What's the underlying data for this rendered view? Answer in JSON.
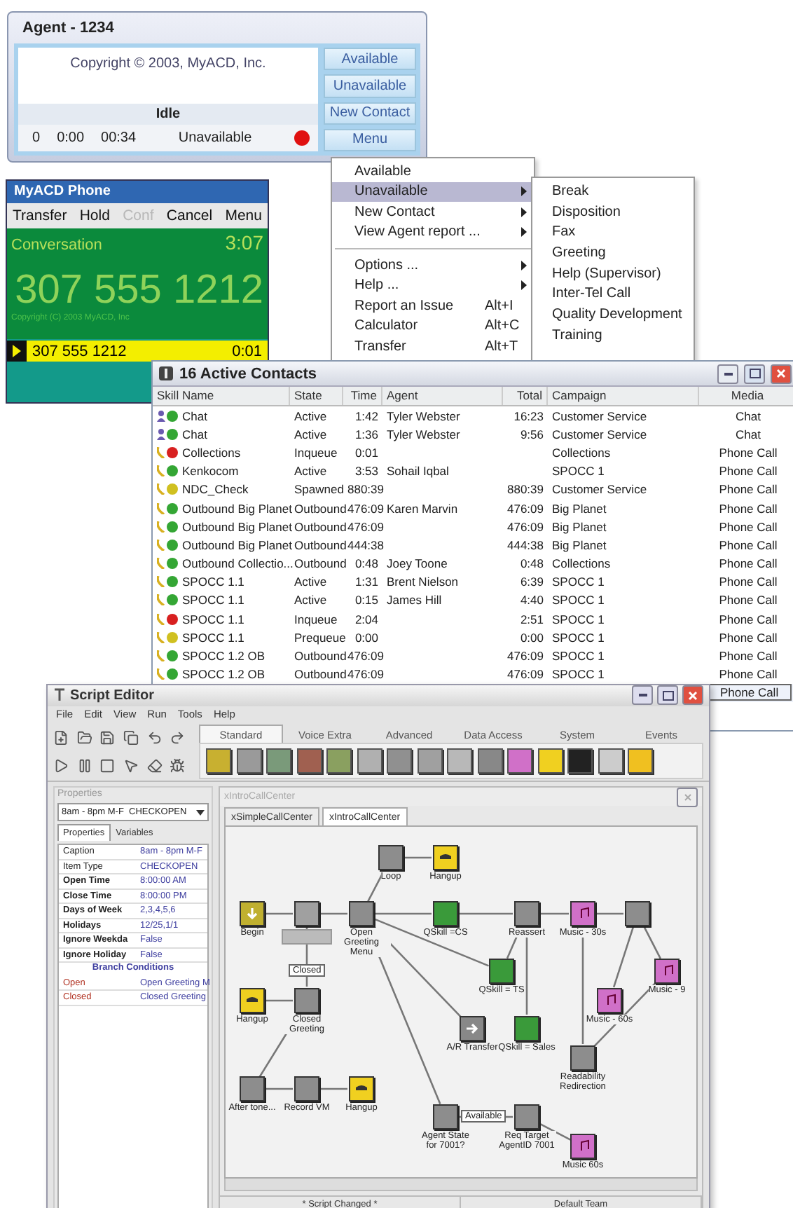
{
  "agent_window": {
    "title": "Agent - 1234",
    "copyright": "Copyright © 2003, MyACD, Inc.",
    "status": "Idle",
    "stats": [
      "0",
      "0:00",
      "00:34"
    ],
    "state": "Unavailable",
    "available": false,
    "buttons": [
      "Available",
      "Unavailable",
      "New Contact",
      "Menu"
    ]
  },
  "menu": {
    "items": [
      {
        "kind": "item",
        "label": "Available",
        "selected": false,
        "submenu": false
      },
      {
        "kind": "item",
        "label": "Unavailable",
        "selected": true,
        "submenu": true
      },
      {
        "kind": "item",
        "label": "New Contact",
        "selected": false,
        "submenu": true
      },
      {
        "kind": "item",
        "label": "View Agent report ...",
        "selected": false,
        "submenu": true
      },
      {
        "kind": "separator"
      },
      {
        "kind": "item",
        "label": "Options ...",
        "selected": false,
        "submenu": true
      },
      {
        "kind": "item",
        "label": "Help ...",
        "selected": false,
        "submenu": true
      },
      {
        "kind": "item",
        "label": "Report an Issue",
        "selected": false,
        "submenu": false,
        "shortcut": "Alt+I"
      },
      {
        "kind": "item",
        "label": "Calculator",
        "selected": false,
        "submenu": false,
        "shortcut": "Alt+C"
      },
      {
        "kind": "item",
        "label": "Transfer",
        "selected": false,
        "submenu": false,
        "shortcut": "Alt+T"
      }
    ]
  },
  "submenu": {
    "items": [
      "Break",
      "Disposition",
      "Fax",
      "Greeting",
      "Help (Supervisor)",
      "Inter-Tel Call",
      "Quality Development",
      "Training"
    ]
  },
  "phone": {
    "title": "MyACD Phone",
    "toolbar": [
      {
        "label": "Transfer",
        "disabled": false
      },
      {
        "label": "Hold",
        "disabled": false
      },
      {
        "label": "Conf",
        "disabled": true
      },
      {
        "label": "Cancel",
        "disabled": false
      },
      {
        "label": "Menu",
        "disabled": false
      }
    ],
    "state": "Conversation",
    "timer": "3:07",
    "number": "307 555 1212",
    "copyright": "Copyright (C) 2003 MyACD, Inc",
    "line": {
      "number": "307 555 1212",
      "time": "0:01"
    }
  },
  "contacts": {
    "title": "16 Active Contacts",
    "columns": [
      "Skill Name",
      "State",
      "Time",
      "Agent",
      "Total",
      "Campaign",
      "Media"
    ],
    "rows": [
      {
        "kind": "chat",
        "color": "#34a634",
        "skill": "Chat",
        "state": "Active",
        "time": "1:42",
        "agent": "Tyler Webster",
        "total": "16:23",
        "campaign": "Customer Service",
        "media": "Chat",
        "selected": false
      },
      {
        "kind": "chat",
        "color": "#34a634",
        "skill": "Chat",
        "state": "Active",
        "time": "1:36",
        "agent": "Tyler Webster",
        "total": "9:56",
        "campaign": "Customer Service",
        "media": "Chat",
        "selected": false
      },
      {
        "kind": "phone",
        "color": "#d82020",
        "skill": "Collections",
        "state": "Inqueue",
        "time": "0:01",
        "campaign": "Collections",
        "media": "Phone Call",
        "selected": false
      },
      {
        "kind": "phone",
        "color": "#34a634",
        "skill": "Kenkocom",
        "state": "Active",
        "time": "3:53",
        "agent": "Sohail Iqbal",
        "campaign": "SPOCC 1",
        "media": "Phone Call",
        "selected": false
      },
      {
        "kind": "phone",
        "color": "#d0c020",
        "skill": "NDC_Check",
        "state": "Spawned",
        "time": "880:39",
        "total": "880:39",
        "campaign": "Customer Service",
        "media": "Phone Call",
        "selected": false
      },
      {
        "kind": "phone",
        "color": "#34a634",
        "skill": "Outbound Big Planet",
        "state": "Outbound",
        "time": "476:09",
        "agent": "Karen Marvin",
        "total": "476:09",
        "campaign": "Big Planet",
        "media": "Phone Call",
        "selected": false
      },
      {
        "kind": "phone",
        "color": "#34a634",
        "skill": "Outbound Big Planet",
        "state": "Outbound",
        "time": "476:09",
        "total": "476:09",
        "campaign": "Big Planet",
        "media": "Phone Call",
        "selected": false
      },
      {
        "kind": "phone",
        "color": "#34a634",
        "skill": "Outbound Big Planet",
        "state": "Outbound",
        "time": "444:38",
        "total": "444:38",
        "campaign": "Big Planet",
        "media": "Phone Call",
        "selected": false
      },
      {
        "kind": "phone",
        "color": "#34a634",
        "skill": "Outbound Collectio...",
        "state": "Outbound",
        "time": "0:48",
        "agent": "Joey Toone",
        "total": "0:48",
        "campaign": "Collections",
        "media": "Phone Call",
        "selected": false
      },
      {
        "kind": "phone",
        "color": "#34a634",
        "skill": "SPOCC 1.1",
        "state": "Active",
        "time": "1:31",
        "agent": "Brent Nielson",
        "total": "6:39",
        "campaign": "SPOCC 1",
        "media": "Phone Call",
        "selected": false
      },
      {
        "kind": "phone",
        "color": "#34a634",
        "skill": "SPOCC 1.1",
        "state": "Active",
        "time": "0:15",
        "agent": "James Hill",
        "total": "4:40",
        "campaign": "SPOCC 1",
        "media": "Phone Call",
        "selected": false
      },
      {
        "kind": "phone",
        "color": "#d82020",
        "skill": "SPOCC 1.1",
        "state": "Inqueue",
        "time": "2:04",
        "total": "2:51",
        "campaign": "SPOCC 1",
        "media": "Phone Call",
        "selected": false
      },
      {
        "kind": "phone",
        "color": "#d0c020",
        "skill": "SPOCC 1.1",
        "state": "Prequeue",
        "time": "0:00",
        "total": "0:00",
        "campaign": "SPOCC 1",
        "media": "Phone Call",
        "selected": false
      },
      {
        "kind": "phone",
        "color": "#34a634",
        "skill": "SPOCC 1.2 OB",
        "state": "Outbound",
        "time": "476:09",
        "total": "476:09",
        "campaign": "SPOCC 1",
        "media": "Phone Call",
        "selected": false
      },
      {
        "kind": "phone",
        "color": "#34a634",
        "skill": "SPOCC 1.2 OB",
        "state": "Outbound",
        "time": "476:09",
        "total": "476:09",
        "campaign": "SPOCC 1",
        "media": "Phone Call",
        "selected": false
      },
      {
        "media": "Phone Call",
        "selected": true
      }
    ]
  },
  "script_editor": {
    "title": "Script Editor",
    "menus": [
      "File",
      "Edit",
      "View",
      "Run",
      "Tools",
      "Help"
    ],
    "palette_tabs": [
      {
        "label": "Standard",
        "selected": true
      },
      {
        "label": "Voice Extra",
        "selected": false
      },
      {
        "label": "Advanced",
        "selected": false
      },
      {
        "label": "Data Access",
        "selected": false
      },
      {
        "label": "System",
        "selected": false
      },
      {
        "label": "Events",
        "selected": false
      }
    ],
    "properties": {
      "title": "Properties",
      "object": "8am - 8pm M-F  CHECKOPEN",
      "tabs": [
        {
          "label": "Properties",
          "selected": true
        },
        {
          "label": "Variables",
          "selected": false
        }
      ],
      "rows": [
        {
          "name": "Caption",
          "value": "8am - 8pm M-F",
          "bold": false
        },
        {
          "name": "Item Type",
          "value": "CHECKOPEN",
          "bold": false
        },
        {
          "name": "Open Time",
          "value": "8:00:00 AM",
          "bold": true
        },
        {
          "name": "Close Time",
          "value": "8:00:00 PM",
          "bold": true
        },
        {
          "name": "Days of Week",
          "value": "2,3,4,5,6",
          "bold": true
        },
        {
          "name": "Holidays",
          "value": "12/25,1/1",
          "bold": true
        },
        {
          "name": "Ignore Weekda",
          "value": "False",
          "bold": true
        },
        {
          "name": "Ignore Holiday",
          "value": "False",
          "bold": true
        }
      ],
      "branch_header": "Branch Conditions",
      "branches": [
        {
          "name": "Open",
          "value": "Open Greeting M"
        },
        {
          "name": "Closed",
          "value": "Closed Greeting"
        }
      ]
    },
    "document": {
      "title": "xIntroCallCenter",
      "tabs": [
        {
          "label": "xSimpleCallCenter",
          "selected": false
        },
        {
          "label": "xIntroCallCenter",
          "selected": true
        }
      ],
      "nodes": [
        {
          "kind": "generic",
          "label": "Loop"
        },
        {
          "kind": "hangup",
          "label": "Hangup"
        },
        {
          "kind": "begin",
          "label": "Begin"
        },
        {
          "kind": "check"
        },
        {
          "kind": "generic",
          "label": "Open Greeting Menu"
        },
        {
          "kind": "queue",
          "label": "QSkill =CS"
        },
        {
          "kind": "generic",
          "label": "Reassert"
        },
        {
          "kind": "music",
          "label": "Music - 30s"
        },
        {
          "kind": "generic"
        },
        {
          "kind": "queue",
          "label": "QSkill = TS"
        },
        {
          "kind": "music",
          "label": "Music - 60s"
        },
        {
          "kind": "music",
          "label": "Music - 9"
        },
        {
          "kind": "hangup",
          "label": "Hangup"
        },
        {
          "kind": "generic",
          "label": "Closed Greeting"
        },
        {
          "kind": "transfer",
          "label": "A/R Transfer"
        },
        {
          "kind": "queue",
          "label": "QSkill = Sales"
        },
        {
          "kind": "generic",
          "label": "Readability Redirection"
        },
        {
          "kind": "generic",
          "label": "After tone..."
        },
        {
          "kind": "generic",
          "label": "Record VM"
        },
        {
          "kind": "hangup",
          "label": "Hangup"
        },
        {
          "kind": "generic",
          "label": "Agent State for 7001?"
        },
        {
          "kind": "generic",
          "label": "Req Target AgentID 7001"
        },
        {
          "kind": "music",
          "label": "Music 60s"
        }
      ],
      "tags": [
        "Closed",
        "Available"
      ],
      "status": [
        "* Script Changed *",
        "Default Team"
      ]
    }
  }
}
